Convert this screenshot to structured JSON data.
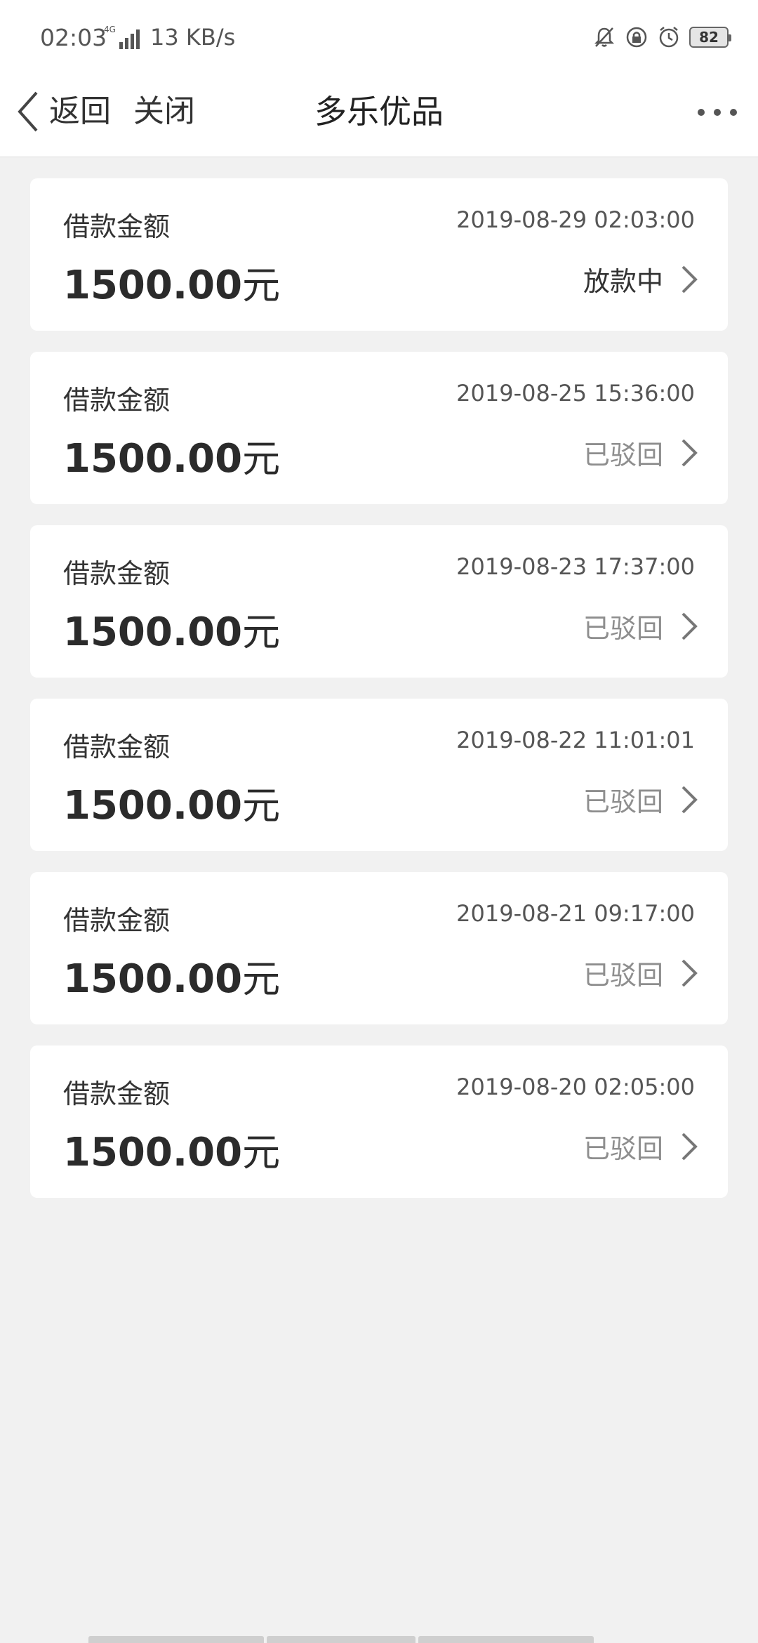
{
  "status_bar": {
    "time": "02:03",
    "network_type": "4G",
    "speed": "13 KB/s",
    "battery": "82",
    "icons": [
      "bell-muted-icon",
      "lock-rotation-icon",
      "alarm-icon"
    ]
  },
  "nav": {
    "back_label": "返回",
    "close_label": "关闭",
    "title": "多乐优品"
  },
  "records": [
    {
      "label": "借款金额",
      "date": "2019-08-29 02:03:00",
      "amount": "1500.00",
      "unit": "元",
      "status": "放款中"
    },
    {
      "label": "借款金额",
      "date": "2019-08-25 15:36:00",
      "amount": "1500.00",
      "unit": "元",
      "status": "已驳回"
    },
    {
      "label": "借款金额",
      "date": "2019-08-23 17:37:00",
      "amount": "1500.00",
      "unit": "元",
      "status": "已驳回"
    },
    {
      "label": "借款金额",
      "date": "2019-08-22 11:01:01",
      "amount": "1500.00",
      "unit": "元",
      "status": "已驳回"
    },
    {
      "label": "借款金额",
      "date": "2019-08-21 09:17:00",
      "amount": "1500.00",
      "unit": "元",
      "status": "已驳回"
    },
    {
      "label": "借款金额",
      "date": "2019-08-20 02:05:00",
      "amount": "1500.00",
      "unit": "元",
      "status": "已驳回"
    }
  ],
  "colors": {
    "background": "#f1f1f1",
    "card": "#ffffff",
    "status_active": "#333333",
    "status_muted": "#8e8e8e"
  }
}
